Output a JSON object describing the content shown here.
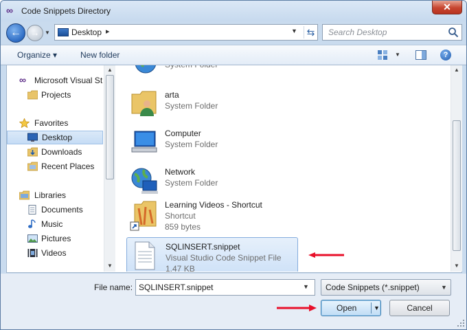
{
  "window": {
    "title": "Code Snippets Directory",
    "close_glyph": "✕",
    "title_icon": "vs-infinity-icon"
  },
  "nav": {
    "back_glyph": "←",
    "forward_glyph": "→",
    "history_glyph": "▼",
    "address": {
      "location": "Desktop",
      "chevron": "▸",
      "drop_glyph": "▼",
      "refresh_glyph": "⇆"
    },
    "search": {
      "placeholder": "Search Desktop"
    }
  },
  "toolbar": {
    "organize_label": "Organize ▾",
    "new_folder_label": "New folder",
    "views_drop_glyph": "▼",
    "help_glyph": "?"
  },
  "sidebar": {
    "items": [
      {
        "label": "Microsoft Visual St",
        "icon": "vs-infinity-icon"
      },
      {
        "label": "Projects",
        "icon": "folder-icon"
      },
      {
        "label": "Favorites",
        "icon": "star-icon"
      },
      {
        "label": "Desktop",
        "icon": "desktop-icon",
        "selected": true
      },
      {
        "label": "Downloads",
        "icon": "downloads-icon"
      },
      {
        "label": "Recent Places",
        "icon": "recent-places-icon"
      },
      {
        "label": "Libraries",
        "icon": "libraries-icon"
      },
      {
        "label": "Documents",
        "icon": "documents-icon"
      },
      {
        "label": "Music",
        "icon": "music-icon"
      },
      {
        "label": "Pictures",
        "icon": "pictures-icon"
      },
      {
        "label": "Videos",
        "icon": "videos-icon"
      }
    ]
  },
  "files": [
    {
      "name": "",
      "type": "System Folder",
      "size": "",
      "icon": "libraries-globe-icon"
    },
    {
      "name": "arta",
      "type": "System Folder",
      "size": "",
      "icon": "user-folder-icon"
    },
    {
      "name": "Computer",
      "type": "System Folder",
      "size": "",
      "icon": "computer-icon"
    },
    {
      "name": "Network",
      "type": "System Folder",
      "size": "",
      "icon": "network-icon"
    },
    {
      "name": "Learning Videos - Shortcut",
      "type": "Shortcut",
      "size": "859 bytes",
      "icon": "shortcut-folder-icon"
    },
    {
      "name": "SQLINSERT.snippet",
      "type": "Visual Studio Code Snippet File",
      "size": "1.47 KB",
      "icon": "snippet-file-icon",
      "selected": true
    }
  ],
  "footer": {
    "file_name_label": "File name:",
    "file_name_value": "SQLINSERT.snippet",
    "file_type": "Code Snippets (*.snippet)",
    "open_label": "Open",
    "cancel_label": "Cancel",
    "drop_glyph": "▼"
  },
  "scrollbar": {
    "up_glyph": "▲",
    "down_glyph": "▼"
  },
  "colors": {
    "annotation_arrow": "#e8102a",
    "selection": "#cfe2f8",
    "accent": "#2d6cc4"
  }
}
